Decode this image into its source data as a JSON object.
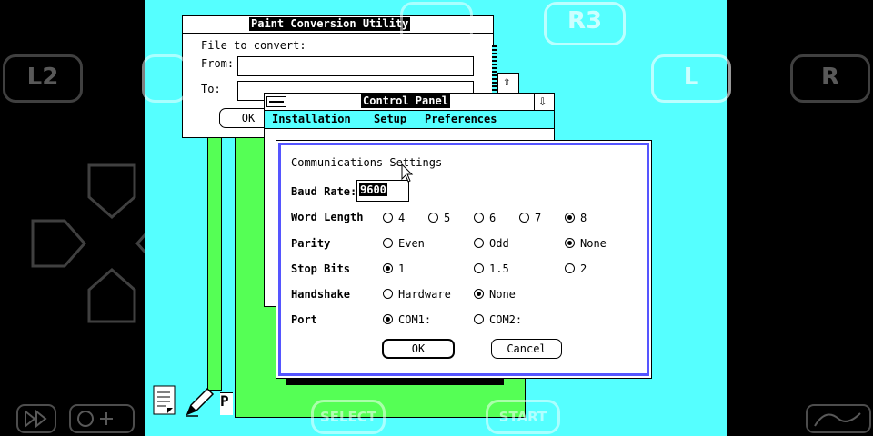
{
  "paint_window": {
    "title": "Paint Conversion Utility",
    "heading": "File to convert:",
    "from_label": "From:",
    "to_label": "To:",
    "from_value": "",
    "to_value": "",
    "ok_label": "OK"
  },
  "control_panel": {
    "title": "Control Panel",
    "menu": [
      "Installation",
      "Setup",
      "Preferences"
    ]
  },
  "dialog": {
    "title": "Communications Settings",
    "baud_label": "Baud Rate:",
    "baud_value": "9600",
    "rows": [
      {
        "label": "Word Length",
        "options": [
          "4",
          "5",
          "6",
          "7",
          "8"
        ],
        "selected": "8"
      },
      {
        "label": "Parity",
        "options": [
          "Even",
          "Odd",
          "None"
        ],
        "selected": "None"
      },
      {
        "label": "Stop Bits",
        "options": [
          "1",
          "1.5",
          "2"
        ],
        "selected": "1"
      },
      {
        "label": "Handshake",
        "options": [
          "Hardware",
          "None"
        ],
        "selected": "None"
      },
      {
        "label": "Port",
        "options": [
          "COM1:",
          "COM2:"
        ],
        "selected": "COM1:"
      }
    ],
    "ok_label": "OK",
    "cancel_label": "Cancel"
  },
  "overlay": {
    "l2": "L2",
    "r3": "R3",
    "l": "L",
    "r": "R",
    "select": "SELECT",
    "start": "START"
  },
  "colors": {
    "desktop": "#55ffff",
    "window_fill": "#55ff55",
    "dialog_border": "#5555ff"
  }
}
